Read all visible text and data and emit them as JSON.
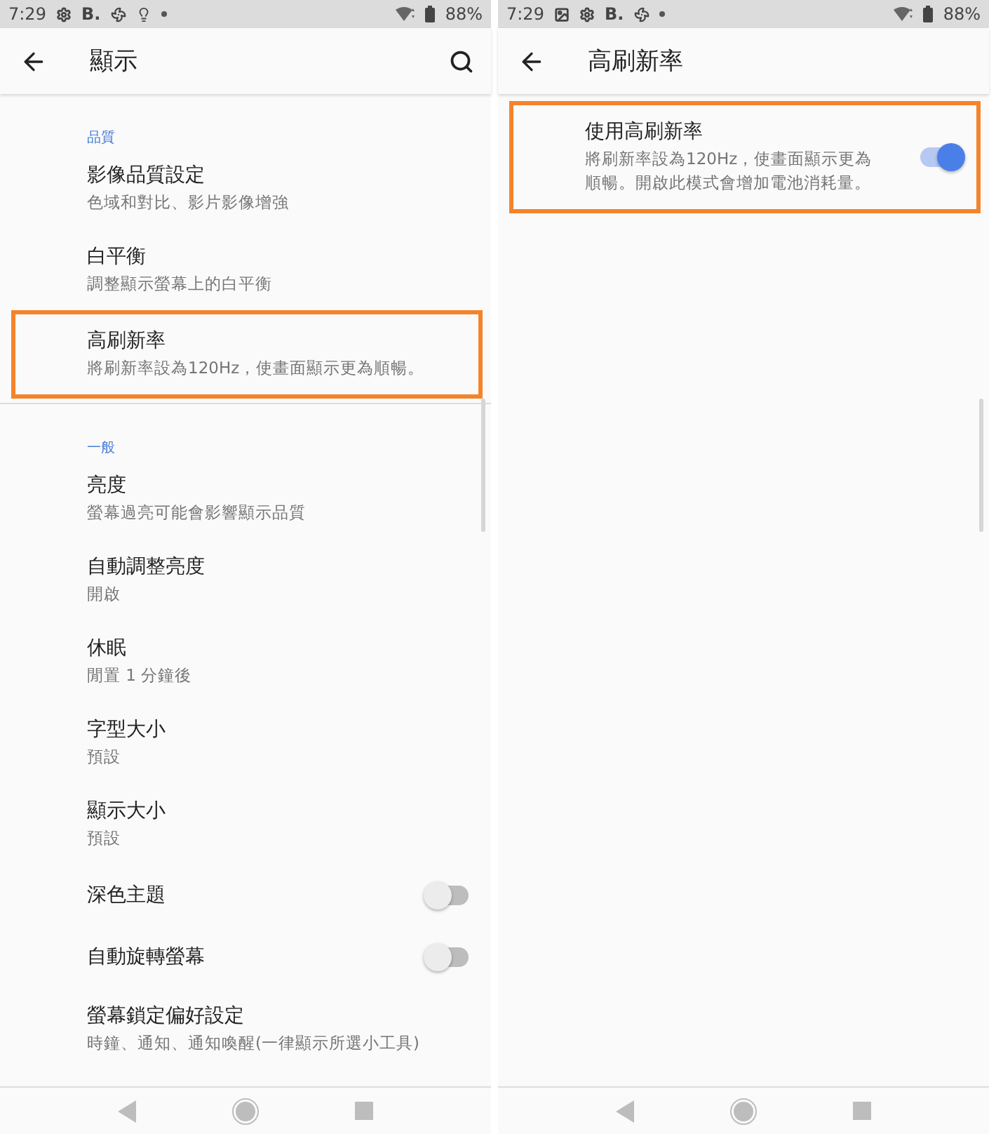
{
  "panels": [
    {
      "status_bar": {
        "time": "7:29",
        "icons": [
          {
            "kind": "gear"
          },
          {
            "kind": "text",
            "text": "B."
          },
          {
            "kind": "fan"
          },
          {
            "kind": "bulb"
          },
          {
            "kind": "dot"
          }
        ],
        "battery": "88%"
      },
      "app_bar": {
        "title": "顯示",
        "search": true
      },
      "sections": [
        {
          "header": "品質",
          "items": [
            {
              "kind": "link",
              "title": "影像品質設定",
              "summary": "色域和對比、影片影像增強",
              "highlighted": false
            },
            {
              "kind": "link",
              "title": "白平衡",
              "summary": "調整顯示螢幕上的白平衡",
              "highlighted": false
            },
            {
              "kind": "link",
              "title": "高刷新率",
              "summary": "將刷新率設為120Hz，使畫面顯示更為順暢。",
              "highlighted": true
            }
          ]
        },
        {
          "header": "一般",
          "items": [
            {
              "kind": "link",
              "title": "亮度",
              "summary": "螢幕過亮可能會影響顯示品質",
              "highlighted": false
            },
            {
              "kind": "link",
              "title": "自動調整亮度",
              "summary": "開啟",
              "highlighted": false
            },
            {
              "kind": "link",
              "title": "休眠",
              "summary": "閒置 1 分鐘後",
              "highlighted": false
            },
            {
              "kind": "link",
              "title": "字型大小",
              "summary": "預設",
              "highlighted": false
            },
            {
              "kind": "link",
              "title": "顯示大小",
              "summary": "預設",
              "highlighted": false
            },
            {
              "kind": "switch",
              "title": "深色主題",
              "on": false,
              "highlighted": false
            },
            {
              "kind": "switch",
              "title": "自動旋轉螢幕",
              "on": false,
              "highlighted": false
            },
            {
              "kind": "link",
              "title": "螢幕鎖定偏好設定",
              "summary": "時鐘、通知、通知喚醒(一律顯示所選小工具)",
              "highlighted": false
            }
          ]
        }
      ]
    },
    {
      "status_bar": {
        "time": "7:29",
        "icons": [
          {
            "kind": "image"
          },
          {
            "kind": "gear"
          },
          {
            "kind": "text",
            "text": "B."
          },
          {
            "kind": "fan"
          },
          {
            "kind": "dot"
          }
        ],
        "battery": "88%"
      },
      "app_bar": {
        "title": "高刷新率",
        "search": false
      },
      "sections": [
        {
          "items": [
            {
              "kind": "switch",
              "title": "使用高刷新率",
              "summary": "將刷新率設為120Hz，使畫面顯示更為順暢。開啟此模式會增加電池消耗量。",
              "on": true,
              "highlighted": true
            }
          ]
        }
      ]
    }
  ]
}
